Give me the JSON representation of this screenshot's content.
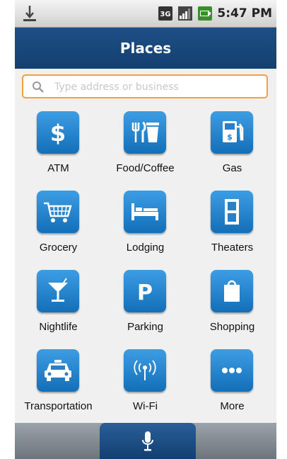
{
  "status_bar": {
    "time": "5:47 PM",
    "icons": [
      "usb-icon",
      "3g-network-icon",
      "signal-icon",
      "battery-icon"
    ]
  },
  "header": {
    "title": "Places"
  },
  "search": {
    "placeholder": "Type address or business",
    "value": ""
  },
  "categories": [
    {
      "label": "ATM",
      "icon": "dollar-icon"
    },
    {
      "label": "Food/Coffee",
      "icon": "fork-knife-cup-icon"
    },
    {
      "label": "Gas",
      "icon": "gas-pump-icon"
    },
    {
      "label": "Grocery",
      "icon": "shopping-cart-icon"
    },
    {
      "label": "Lodging",
      "icon": "bed-icon"
    },
    {
      "label": "Theaters",
      "icon": "film-icon"
    },
    {
      "label": "Nightlife",
      "icon": "cocktail-icon"
    },
    {
      "label": "Parking",
      "icon": "parking-icon"
    },
    {
      "label": "Shopping",
      "icon": "shopping-bag-icon"
    },
    {
      "label": "Transportation",
      "icon": "taxi-icon"
    },
    {
      "label": "Wi-Fi",
      "icon": "wifi-icon"
    },
    {
      "label": "More",
      "icon": "more-dots-icon"
    }
  ],
  "bottom_bar": {
    "icon": "microphone-icon"
  },
  "colors": {
    "header_blue": "#1d4e86",
    "tile_blue": "#2585d0",
    "search_border": "#f0a040",
    "background": "#f0f0f0"
  }
}
